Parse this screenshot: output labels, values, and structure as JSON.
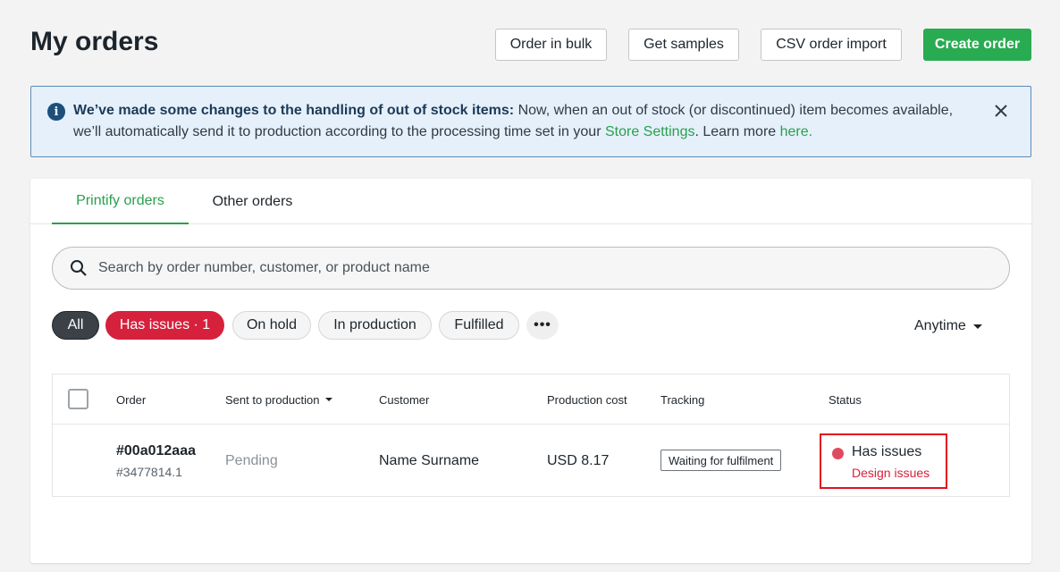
{
  "header": {
    "title": "My orders",
    "buttons": {
      "bulk": "Order in bulk",
      "samples": "Get samples",
      "csv": "CSV order import",
      "create": "Create order"
    }
  },
  "notice": {
    "bold": "We’ve made some changes to the handling of out of stock items:",
    "text1": " Now, when an out of stock (or discontinued) item becomes available, we’ll automatically send it to production according to the processing time set in your ",
    "link1": "Store Settings",
    "text2": ". Learn more ",
    "link2": "here."
  },
  "tabs": [
    "Printify orders",
    "Other orders"
  ],
  "search": {
    "placeholder": "Search by order number, customer, or product name"
  },
  "filters": {
    "all": "All",
    "has_issues": "Has issues · 1",
    "on_hold": "On hold",
    "in_production": "In production",
    "fulfilled": "Fulfilled",
    "more": "•••"
  },
  "date_filter": "Anytime",
  "table": {
    "headers": {
      "order": "Order",
      "sent": "Sent to production",
      "customer": "Customer",
      "cost": "Production cost",
      "tracking": "Tracking",
      "status": "Status"
    },
    "rows": [
      {
        "order_id": "#00a012aaa",
        "order_sub": "#3477814.1",
        "sent": "Pending",
        "customer": "Name Surname",
        "cost": "USD 8.17",
        "tracking": "Waiting for fulfilment",
        "status": "Has issues",
        "status_detail": "Design issues"
      }
    ]
  },
  "colors": {
    "brand_green": "#29ab51",
    "issue_red": "#d6213d",
    "highlight_red": "#e0121f",
    "info_blue": "#1d4f7c"
  }
}
